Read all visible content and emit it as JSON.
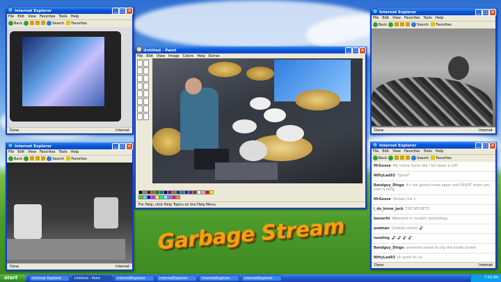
{
  "stream_title": "Garbage Stream",
  "ie_window": {
    "title": "Internet Explorer",
    "menu": [
      "File",
      "Edit",
      "View",
      "Favorites",
      "Tools",
      "Help"
    ],
    "toolbar": {
      "back": "Back",
      "search": "Search",
      "favorites": "Favorites"
    },
    "status_done": "Done",
    "status_zone": "Internet"
  },
  "paint_window": {
    "title": "Untitled - Paint",
    "menu": [
      "File",
      "Edit",
      "View",
      "Image",
      "Colors",
      "Help",
      "Extras"
    ],
    "status": "For Help, click Help Topics on the Help Menu.",
    "palette": [
      "#000000",
      "#808080",
      "#800000",
      "#808000",
      "#008000",
      "#008080",
      "#000080",
      "#800080",
      "#808040",
      "#004040",
      "#0080ff",
      "#004080",
      "#8000ff",
      "#804000",
      "#ffffff",
      "#c0c0c0",
      "#ff0000",
      "#ffff00",
      "#00ff00",
      "#00ffff",
      "#0000ff",
      "#ff00ff",
      "#ffff80",
      "#00ff80",
      "#80ffff",
      "#8080ff",
      "#ff0080",
      "#ff8040"
    ]
  },
  "chat": {
    "messages": [
      {
        "user": "MrGoose",
        "text": "My online hunts like I fell down a cliff"
      },
      {
        "user": "NiftyLad93",
        "text": "*good*"
      },
      {
        "user": "Bandguy_Dingo",
        "text": "it's not gonna know again until RIGHT when you start a song"
      },
      {
        "user": "MrGoose",
        "text": "Stream the 1"
      },
      {
        "user": "i_do_know_jack",
        "text": "THE SECRETS"
      },
      {
        "user": "benwrth",
        "text": "Welcome to modern technology"
      },
      {
        "user": "podman",
        "text": "Cookies crimes 🦨"
      },
      {
        "user": "luneling",
        "text": "🦨 🦨 🦨 🦨"
      },
      {
        "user": "Bandguy_Dingo",
        "text": "someone needs to clip the inside screen"
      },
      {
        "user": "NiftyLad93",
        "text": "oh good oh no"
      }
    ]
  },
  "taskbar": {
    "start": "start",
    "buttons": [
      "Internet Explorer",
      "Untitled - Paint",
      "InternetExplorer",
      "InternetExplorer",
      "InternetExplorer",
      "InternetExplorer"
    ],
    "clock": "7:59 PM"
  }
}
